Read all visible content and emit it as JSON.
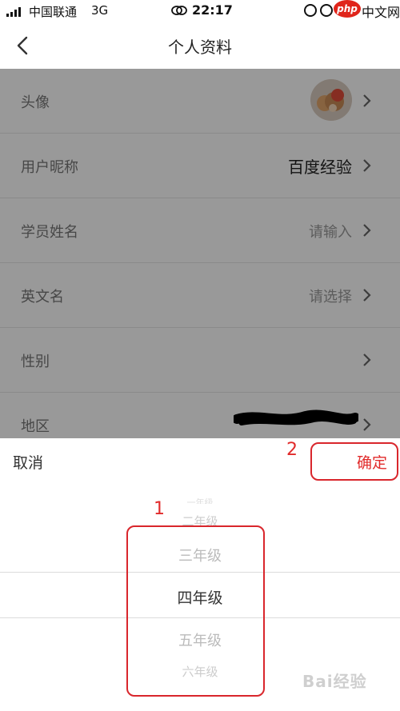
{
  "status_bar": {
    "carrier": "中国联通",
    "network": "3G",
    "time": "22:17",
    "badge_php": "php",
    "badge_cn": "中文网"
  },
  "nav": {
    "title": "个人资料"
  },
  "form": {
    "rows": [
      {
        "label": "头像",
        "value": ""
      },
      {
        "label": "用户昵称",
        "value": "百度经验"
      },
      {
        "label": "学员姓名",
        "value": "请输入"
      },
      {
        "label": "英文名",
        "value": "请选择"
      },
      {
        "label": "性别",
        "value": ""
      },
      {
        "label": "地区",
        "value": ""
      }
    ]
  },
  "picker": {
    "cancel_label": "取消",
    "confirm_label": "确定",
    "options": [
      "一年级",
      "二年级",
      "三年级",
      "四年级",
      "五年级",
      "六年级"
    ],
    "selected": "四年级"
  },
  "annotations": {
    "marker_1": "1",
    "marker_2": "2",
    "color": "#d9262c"
  },
  "watermark": "Bai经验"
}
